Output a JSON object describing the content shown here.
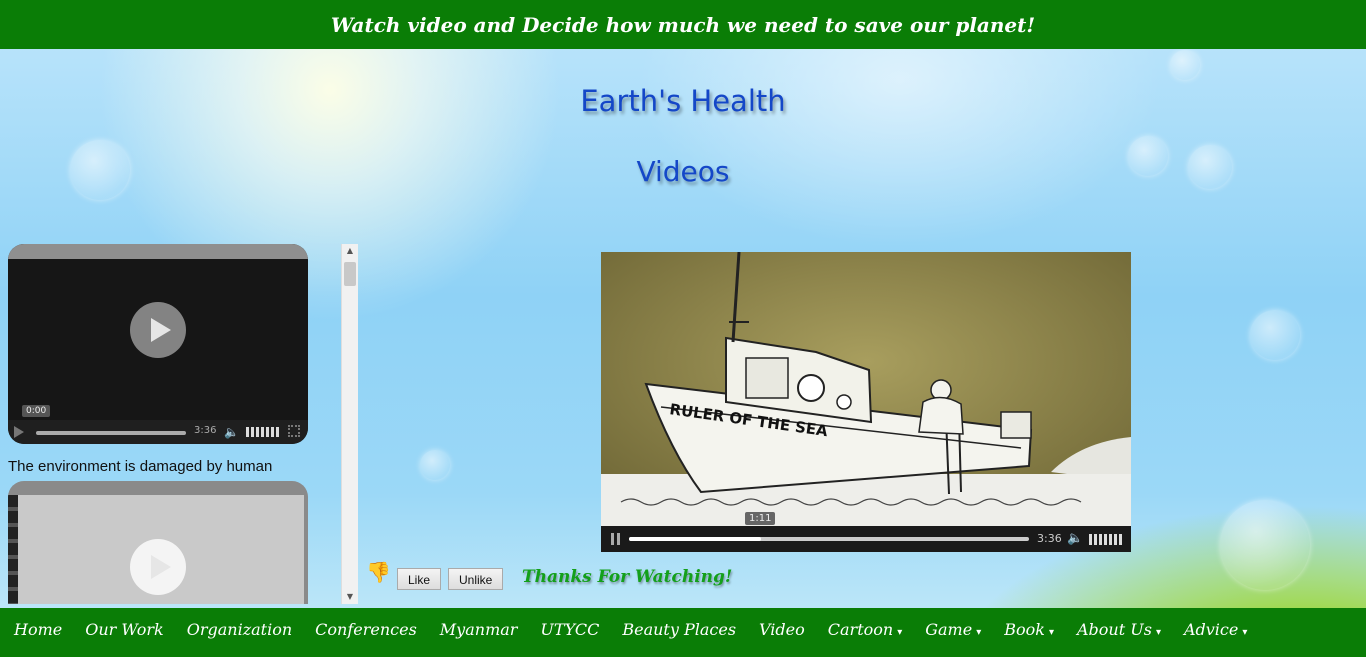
{
  "banner": {
    "text": "Watch video and Decide how much we need to save our planet!"
  },
  "page": {
    "title": "Earth's Health",
    "subtitle": "Videos"
  },
  "sidebar": {
    "videos": [
      {
        "tooltip": "0:00",
        "duration": "3:36",
        "caption": "The environment is damaged by human"
      },
      {
        "caption": ""
      }
    ]
  },
  "player": {
    "current_time": "1:11",
    "duration": "3:36",
    "progress": 0.33,
    "scene_text": "RULER OF THE SEA"
  },
  "feedback": {
    "like_label": "Like",
    "unlike_label": "Unlike",
    "thanks_text": "Thanks For Watching!"
  },
  "nav": {
    "items": [
      {
        "label": "Home",
        "dot": ""
      },
      {
        "label": "Our Work",
        "dot": ""
      },
      {
        "label": "Organization",
        "dot": ""
      },
      {
        "label": "Conferences",
        "dot": ""
      },
      {
        "label": "Myanmar",
        "dot": ""
      },
      {
        "label": "UTYCC",
        "dot": ""
      },
      {
        "label": "Beauty Places",
        "dot": ""
      },
      {
        "label": "Video",
        "dot": ""
      },
      {
        "label": "Cartoon",
        "dot": "▾"
      },
      {
        "label": "Game",
        "dot": "▾"
      },
      {
        "label": "Book",
        "dot": "▾"
      },
      {
        "label": "About Us",
        "dot": "▾"
      },
      {
        "label": "Advice",
        "dot": "▾"
      }
    ]
  },
  "colors": {
    "bar_green": "#0a7d06",
    "heading_blue": "#1447c8",
    "thanks_green": "#13a01a"
  }
}
